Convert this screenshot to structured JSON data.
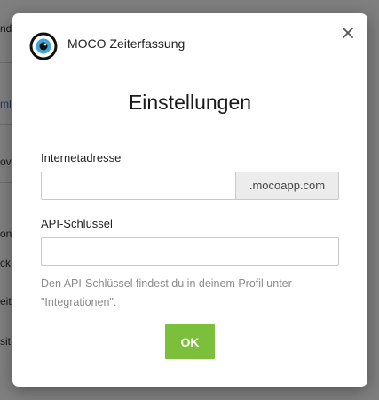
{
  "background": {
    "fragments": [
      "ndi",
      "ml",
      "ovi",
      "on",
      "ck",
      "eit",
      "sit"
    ]
  },
  "dialog": {
    "app_name": "MOCO Zeiterfassung",
    "logo_icon": "moco-eye-logo-icon",
    "close_icon": "close-icon",
    "title": "Einstellungen",
    "url_label": "Internetadresse",
    "url_value": "",
    "url_suffix": ".mocoapp.com",
    "api_key_label": "API-Schlüssel",
    "api_key_value": "",
    "help_text": "Den API-Schlüssel findest du in deinem Profil unter \"Integrationen\".",
    "ok_label": "OK"
  },
  "colors": {
    "accent": "#7bbf3b",
    "overlay": "rgba(0,0,0,0.5)",
    "help_text": "#8a8a8a",
    "addon_bg": "#ececec"
  }
}
